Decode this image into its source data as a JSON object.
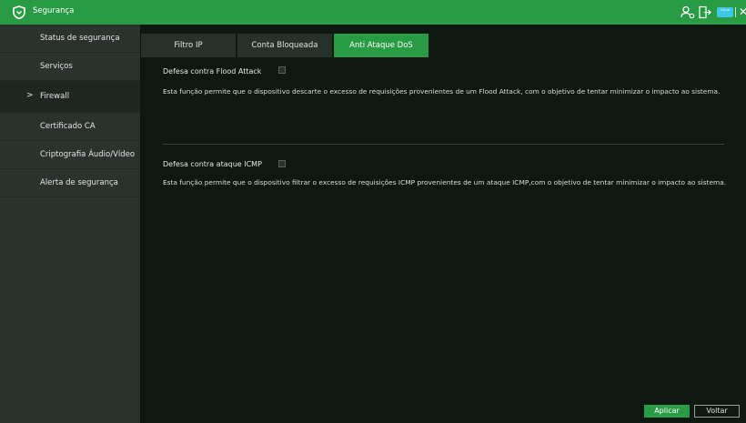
{
  "window": {
    "title": "Segurança",
    "cloud_badge_text": "Cloud"
  },
  "sidebar": {
    "items": [
      {
        "label": "Status de segurança"
      },
      {
        "label": "Serviços"
      },
      {
        "label": "Firewall",
        "arrow": ">"
      },
      {
        "label": "Certificado CA"
      },
      {
        "label": "Criptografia Áudio/Vídeo"
      },
      {
        "label": "Alerta de segurança"
      }
    ],
    "active_index": 2
  },
  "tabs": [
    {
      "label": "Filtro IP"
    },
    {
      "label": "Conta Bloqueada"
    },
    {
      "label": "Anti Ataque DoS"
    }
  ],
  "active_tab": 2,
  "flood": {
    "label": "Defesa contra Flood Attack",
    "checked": false,
    "description": "Esta função permite que o dispositivo descarte o excesso de requisições provenientes de um Flood Attack, com o objetivo de tentar minimizar o impacto ao sistema."
  },
  "icmp": {
    "label": "Defesa contra ataque ICMP",
    "checked": false,
    "description": "Esta função permite que o dispositivo filtrar o excesso de requisições ICMP provenientes de um ataque ICMP,com o objetivo de tentar minimizar o impacto ao sistema."
  },
  "buttons": {
    "apply": "Aplicar",
    "back": "Voltar"
  },
  "colors": {
    "accent": "#2a9b45",
    "sidebar": "#2b322d",
    "background": "#0f1711"
  },
  "icons": {
    "title": "shield-icon",
    "user": "user-settings-icon",
    "logout": "logout-icon",
    "cloud": "cloud-icon",
    "close": "close-icon"
  }
}
